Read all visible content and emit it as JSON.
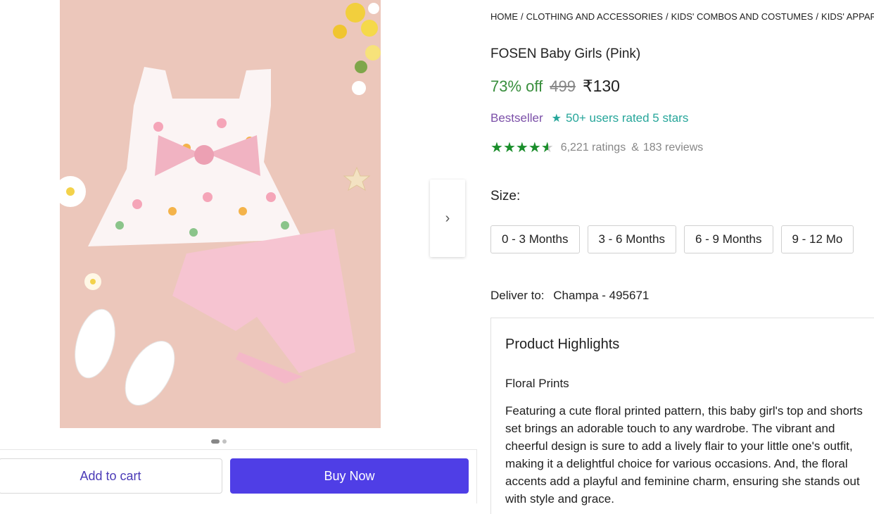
{
  "breadcrumb": [
    "HOME",
    "CLOTHING AND ACCESSORIES",
    "KIDS' COMBOS AND COSTUMES",
    "KIDS' APPAREL"
  ],
  "product": {
    "title": "FOSEN Baby Girls (Pink)",
    "discount": "73% off",
    "mrp": "499",
    "price": "₹130",
    "bestseller": "Bestseller",
    "rated_badge": "50+ users rated 5 stars",
    "rating_value": 4.5,
    "ratings_count": "6,221 ratings",
    "reviews_count": "183 reviews",
    "amp": "&"
  },
  "gallery": {
    "image_count": 2,
    "active_index": 0,
    "next_icon": "chevron-right-icon"
  },
  "size": {
    "label": "Size:",
    "options": [
      "0 - 3 Months",
      "3 - 6 Months",
      "6 - 9 Months",
      "9 - 12 Mo"
    ]
  },
  "delivery": {
    "label": "Deliver to:",
    "location": "Champa - 495671"
  },
  "highlights": {
    "title": "Product Highlights",
    "subtitle": "Floral Prints",
    "text": "Featuring a cute floral printed pattern, this baby girl's top and shorts set brings an adorable touch to any wardrobe. The vibrant and cheerful design is sure to add a lively flair to your little one's outfit, making it a delightful choice for various occasions. And, the floral accents add a playful and feminine charm, ensuring she stands out with style and grace."
  },
  "actions": {
    "add_to_cart": "Add to cart",
    "buy_now": "Buy Now"
  },
  "colors": {
    "discount_green": "#388e3c",
    "star_green": "#1a8e2b",
    "buy_button": "#4f3ee6",
    "bestseller_purple": "#7b4fa8",
    "rated_teal": "#26a69a",
    "image_background": "#ecc7bb"
  }
}
